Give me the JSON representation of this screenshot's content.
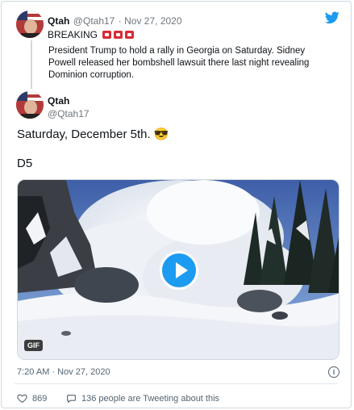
{
  "quoted": {
    "name": "Qtah",
    "handle": "@Qtah17",
    "date": "· Nov 27, 2020",
    "breaking": "BREAKING",
    "text": "President Trump to hold a rally in Georgia on Saturday. Sidney Powell released her bombshell lawsuit there last night revealing Dominion corruption."
  },
  "tweet": {
    "name": "Qtah",
    "handle": "@Qtah17",
    "text": "Saturday, December 5th. 😎",
    "text2": "D5",
    "media_badge": "GIF",
    "timestamp": "7:20 AM · Nov 27, 2020",
    "likes": "869",
    "conversation": "136 people are Tweeting about this"
  },
  "colors": {
    "accent": "#1d9bf0",
    "text": "#0f1419",
    "muted": "#536471"
  },
  "icons": [
    "twitter-bird-icon",
    "play-icon",
    "info-icon",
    "heart-icon",
    "comment-icon",
    "flag-emoji-icon",
    "sunglasses-emoji-icon"
  ]
}
